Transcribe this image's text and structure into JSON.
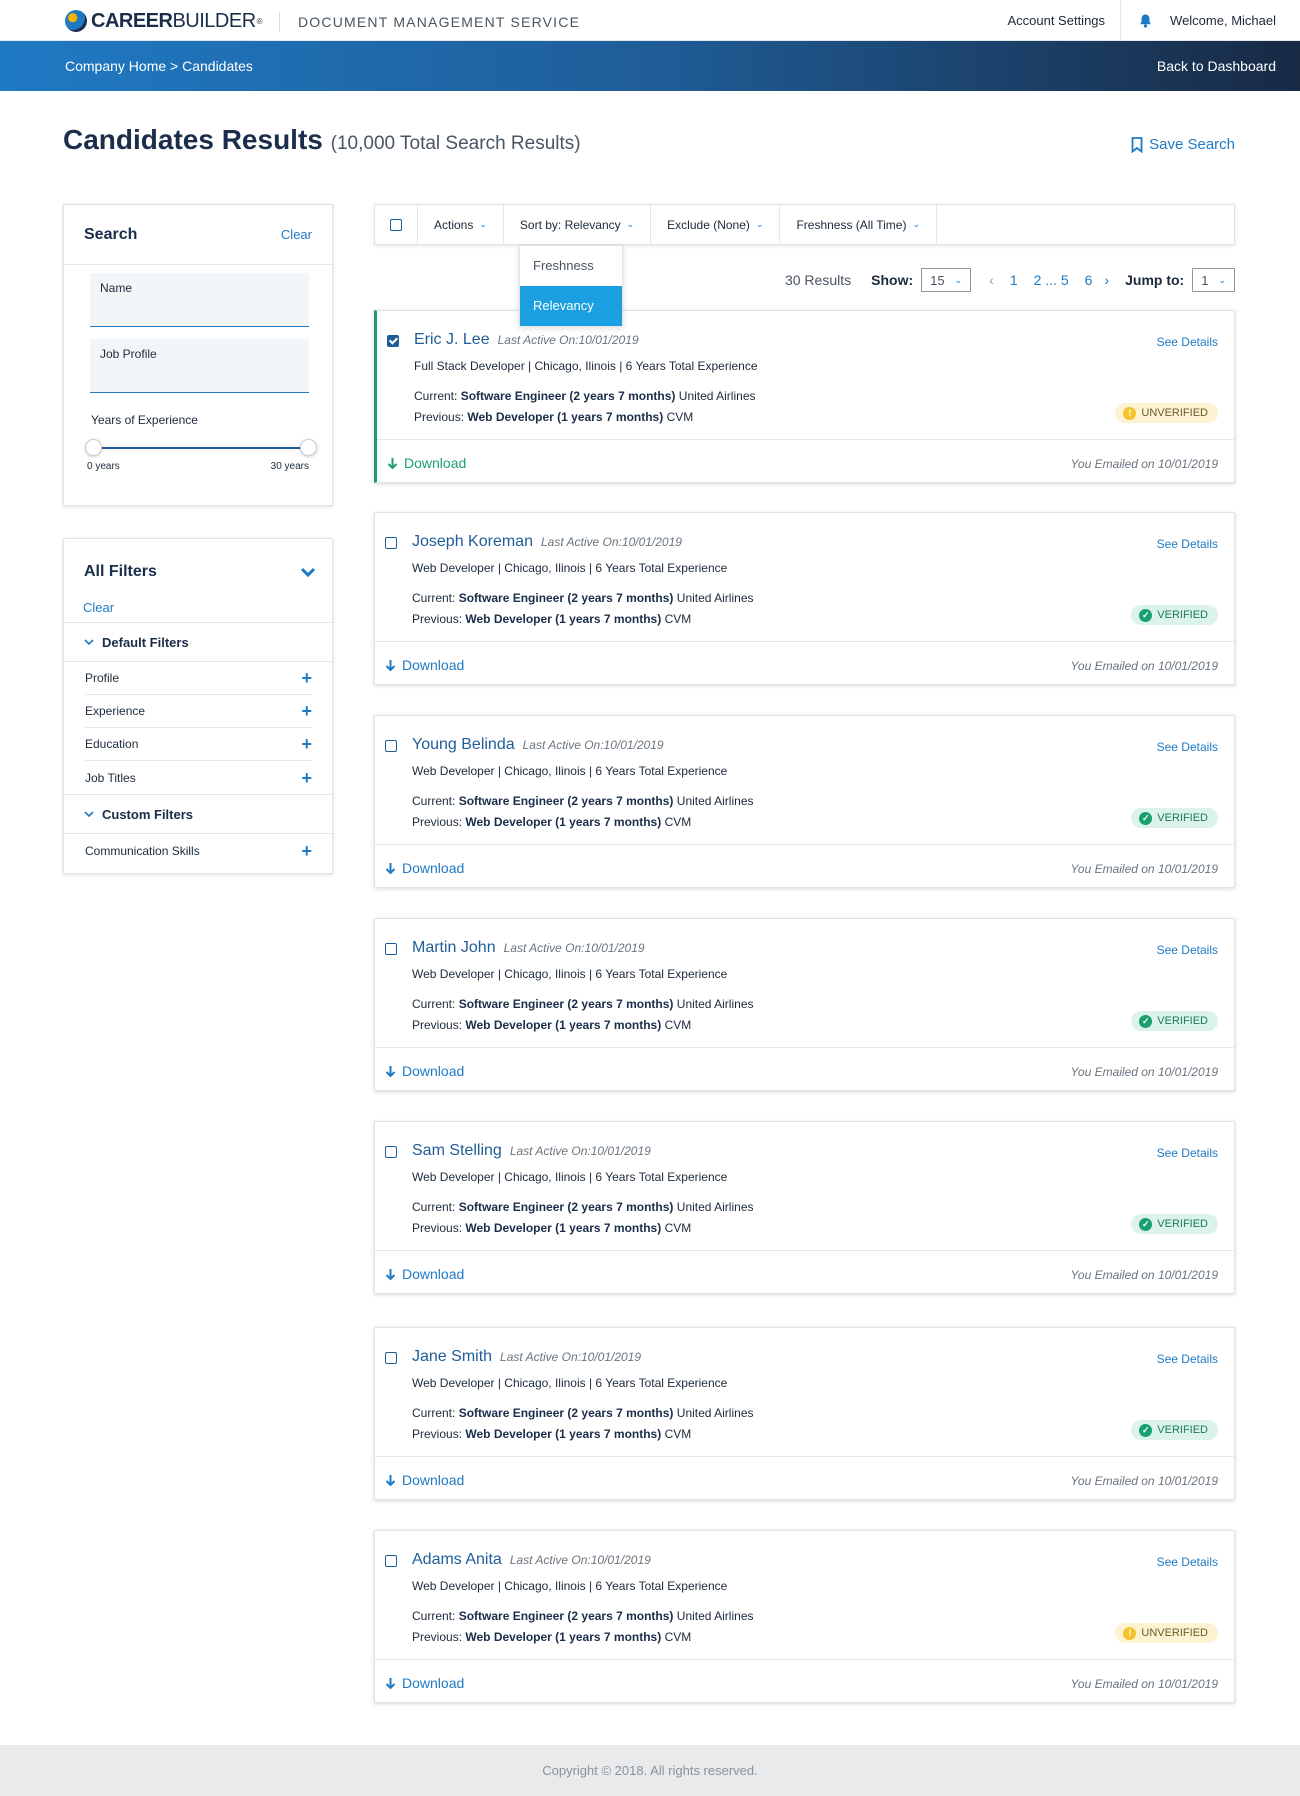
{
  "header": {
    "logo_text": "CAREERBUILDER",
    "app_title": "DOCUMENT MANAGEMENT SERVICE",
    "account_settings": "Account Settings",
    "welcome": "Welcome, Michael",
    "bell_icon": "bell-icon"
  },
  "hero": {
    "breadcrumb": "Company Home > Candidates",
    "back": "Back to Dashboard"
  },
  "page": {
    "title": "Candidates Results",
    "subtitle": "(10,000 Total Search Results)",
    "save_search": "Save Search"
  },
  "search_panel": {
    "title": "Search",
    "clear": "Clear",
    "name_label": "Name",
    "job_profile_label": "Job Profile",
    "yoe_label": "Years of Experience",
    "min_label": "0 years",
    "max_label": "30 years"
  },
  "filters_panel": {
    "title": "All Filters",
    "clear": "Clear",
    "default_group": "Default Filters",
    "default_items": [
      "Profile",
      "Experience",
      "Education",
      "Job Titles"
    ],
    "custom_group": "Custom Filters",
    "custom_items": [
      "Communication Skills"
    ]
  },
  "toolbar": {
    "actions": "Actions",
    "sort": "Sort by: Relevancy",
    "exclude": "Exclude (None)",
    "freshness": "Freshness (All Time)"
  },
  "sort_dropdown": {
    "options": [
      "Freshness",
      "Relevancy"
    ],
    "selected": "Relevancy"
  },
  "pager": {
    "results": "30 Results",
    "show_label": "Show:",
    "show_value": "15",
    "pages": [
      "1",
      "2 ... 5",
      "6"
    ],
    "jump_label": "Jump to:",
    "jump_value": "1"
  },
  "labels": {
    "current": "Current:",
    "previous": "Previous:",
    "see_details": "See Details",
    "download": "Download",
    "verified": "VERIFIED",
    "unverified": "UNVERIFIED"
  },
  "candidates": [
    {
      "name": "Eric J. Lee",
      "last_active": "Last Active On:10/01/2019",
      "meta": "Full Stack Developer  |  Chicago,  Ilinois  |  6 Years Total Experience",
      "current_job": "Software Engineer (2 years 7 months)",
      "current_company": "United Airlines",
      "previous_job": "Web Developer (1 years 7 months)",
      "previous_company": "CVM",
      "status": "UNVERIFIED",
      "emailed": "You Emailed on 10/01/2019",
      "checked": true
    },
    {
      "name": "Joseph Koreman",
      "last_active": "Last Active On:10/01/2019",
      "meta": "Web Developer  |  Chicago,  Ilinois  |  6 Years Total Experience",
      "current_job": "Software Engineer (2 years 7 months)",
      "current_company": "United Airlines",
      "previous_job": "Web Developer (1 years 7 months)",
      "previous_company": "CVM",
      "status": "VERIFIED",
      "emailed": "You Emailed on 10/01/2019",
      "checked": false
    },
    {
      "name": "Young Belinda",
      "last_active": "Last Active On:10/01/2019",
      "meta": "Web Developer  |  Chicago,  Ilinois  |  6 Years Total Experience",
      "current_job": "Software Engineer (2 years 7 months)",
      "current_company": "United Airlines",
      "previous_job": "Web Developer (1 years 7 months)",
      "previous_company": "CVM",
      "status": "VERIFIED",
      "emailed": "You Emailed on 10/01/2019",
      "checked": false
    },
    {
      "name": "Martin John",
      "last_active": "Last Active On:10/01/2019",
      "meta": "Web Developer  |  Chicago,  Ilinois  |  6 Years Total Experience",
      "current_job": "Software Engineer (2 years 7 months)",
      "current_company": "United Airlines",
      "previous_job": "Web Developer (1 years 7 months)",
      "previous_company": "CVM",
      "status": "VERIFIED",
      "emailed": "You Emailed on 10/01/2019",
      "checked": false
    },
    {
      "name": "Sam Stelling",
      "last_active": "Last Active On:10/01/2019",
      "meta": "Web Developer  |  Chicago,  Ilinois  |  6 Years Total Experience",
      "current_job": "Software Engineer (2 years 7 months)",
      "current_company": "United Airlines",
      "previous_job": "Web Developer (1 years 7 months)",
      "previous_company": "CVM",
      "status": "VERIFIED",
      "emailed": "You Emailed on 10/01/2019",
      "checked": false
    },
    {
      "name": "Jane Smith",
      "last_active": "Last Active On:10/01/2019",
      "meta": "Web Developer  |  Chicago,  Ilinois  |  6 Years Total Experience",
      "current_job": "Software Engineer (2 years 7 months)",
      "current_company": "United Airlines",
      "previous_job": "Web Developer (1 years 7 months)",
      "previous_company": "CVM",
      "status": "VERIFIED",
      "emailed": "You Emailed on 10/01/2019",
      "checked": false
    },
    {
      "name": "Adams Anita",
      "last_active": "Last Active On:10/01/2019",
      "meta": "Web Developer  |  Chicago,  Ilinois  |  6 Years Total Experience",
      "current_job": "Software Engineer (2 years 7 months)",
      "current_company": "United Airlines",
      "previous_job": "Web Developer (1 years 7 months)",
      "previous_company": "CVM",
      "status": "UNVERIFIED",
      "emailed": "You Emailed on 10/01/2019",
      "checked": false
    }
  ],
  "footer": {
    "copyright": "Copyright © 2018. All rights reserved."
  },
  "colors": {
    "brand_blue": "#1f7ac4",
    "navy": "#1a2d4a",
    "verified_green": "#1aa06e",
    "unverified_yellow": "#f5c32c",
    "dropdown_active": "#1aa0e0"
  }
}
